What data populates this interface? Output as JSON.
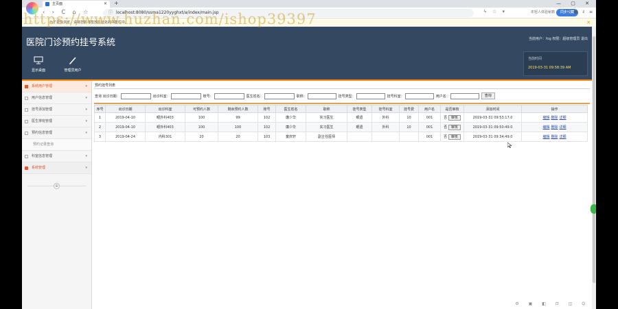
{
  "browser": {
    "tab_title": "主页面",
    "new_tab": "+",
    "window_controls": "— ▢ ✕",
    "nav_buttons": "‹ › C ⌂ ☆",
    "url": "localhost:8080/ssma1220yyghxt/a/index/main.jsp",
    "url_prefix": "ⓘ",
    "addr_right": "ϟ ☆ ▾",
    "search_hint": "年轻人体验秘籍",
    "sync_label": "同步收藏",
    "ext_icons": "Q ▦ ⇓ ≡",
    "bookmark_text": "为了更快浏览，请将您的书签放在此处的书签栏中。",
    "bookmark_close": "✕"
  },
  "header": {
    "title": "医院门诊预约挂号系统",
    "user_info": "当前用户：fog 权限：超级管理员 退出",
    "quick_buttons": [
      {
        "label": "显示桌面",
        "icon": "monitor-icon"
      },
      {
        "label": "管理员用户",
        "icon": "pencil-icon"
      }
    ],
    "time_label": "当前时间",
    "time_value": "2019-03-31 09:58:39 AM"
  },
  "sidebar": {
    "items": [
      {
        "label": "系统用户管理",
        "state": "active"
      },
      {
        "label": "用户信息管理",
        "state": "normal"
      },
      {
        "label": "挂号添加管理",
        "state": "normal"
      },
      {
        "label": "医生排班管理",
        "state": "normal"
      },
      {
        "label": "预约信息管理",
        "state": "normal"
      },
      {
        "label": "预约记录查询",
        "state": "sub"
      },
      {
        "label": "科室信息管理",
        "state": "normal"
      },
      {
        "label": "系统管理",
        "state": "hl"
      }
    ],
    "collapse_symbol": "⊕"
  },
  "panel": {
    "title": "预约挂号列表",
    "filters": [
      {
        "label": "查询 出诊日期："
      },
      {
        "label": "出诊科室："
      },
      {
        "label": "账号："
      },
      {
        "label": "医生姓名："
      },
      {
        "label": "职称："
      },
      {
        "label": "挂号类型："
      },
      {
        "label": "挂号科室："
      },
      {
        "label": "用户名："
      }
    ],
    "search_label": "查询"
  },
  "table": {
    "headers": [
      "序号",
      "出诊日期",
      "出诊科室",
      "可预约人数",
      "剩余预约人数",
      "账号",
      "医生姓名",
      "职称",
      "挂号类型",
      "挂号科室",
      "挂号费",
      "用户名",
      "是否审核",
      "添加时间",
      "操作"
    ],
    "rows": [
      {
        "index": "1",
        "date": "2019-04-10",
        "dept": "眼外科403",
        "capacity": "100",
        "remaining": "99",
        "account": "102",
        "doctor": "廉少华",
        "rank": "实习医生",
        "type": "眼遗",
        "reg_dept": "外科",
        "fee": "10",
        "user": "001",
        "reviewed": "否",
        "review_btn": "审核",
        "added": "2019-03-31 09:53:17.0",
        "op_edit": "编辑",
        "op_delete": "删除",
        "op_detail": "详细"
      },
      {
        "index": "2",
        "date": "2019-04-10",
        "dept": "眼外科403",
        "capacity": "100",
        "remaining": "100",
        "account": "102",
        "doctor": "廉少华",
        "rank": "实习医生",
        "type": "眼遗",
        "reg_dept": "外科",
        "fee": "10",
        "user": "001",
        "reviewed": "否",
        "review_btn": "审核",
        "added": "2019-03-31 09:50:49.0",
        "op_edit": "编辑",
        "op_delete": "删除",
        "op_detail": "详细"
      },
      {
        "index": "3",
        "date": "2019-04-24",
        "dept": "内科301",
        "capacity": "20",
        "remaining": "20",
        "account": "103",
        "doctor": "童庆轩",
        "rank": "副主任医师",
        "type": "",
        "reg_dept": "",
        "fee": "",
        "user": "001",
        "reviewed": "否",
        "review_btn": "审核",
        "added": "2019-03-31 09:34:49.0",
        "op_edit": "编辑",
        "op_delete": "删除",
        "op_detail": "详细"
      }
    ]
  },
  "status_icons": "⚙ ▣ ◧ ⊡ ◫ Q",
  "watermark": "https://www.huzhan.com/ishop39397",
  "colors": {
    "header_bg": "#344961",
    "accent": "#ff8a00",
    "sidebar_active": "#e4572e",
    "link": "#2a4aa8"
  }
}
